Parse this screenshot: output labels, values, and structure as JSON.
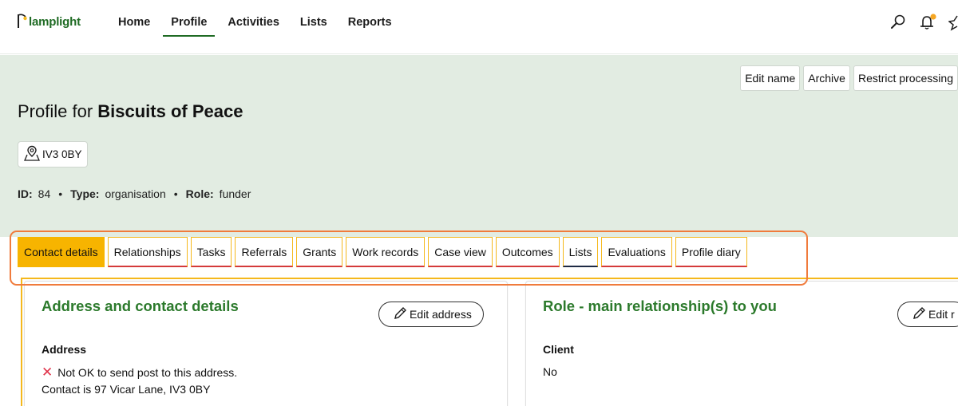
{
  "app": {
    "logo_text": "lamplight"
  },
  "nav": {
    "items": [
      "Home",
      "Profile",
      "Activities",
      "Lists",
      "Reports"
    ],
    "active": 1
  },
  "icons": {
    "search": "search-icon",
    "notifications": "bell-icon",
    "star": "star-icon"
  },
  "header": {
    "buttons": [
      "Edit name",
      "Archive",
      "Restrict processing"
    ],
    "title_prefix": "Profile for ",
    "title_name": "Biscuits of Peace",
    "postcode": "IV3 0BY",
    "meta": {
      "id_label": "ID:",
      "id_value": "84",
      "type_label": "Type:",
      "type_value": "organisation",
      "role_label": "Role:",
      "role_value": "funder",
      "separator": "•"
    }
  },
  "tabs": [
    "Contact details",
    "Relationships",
    "Tasks",
    "Referrals",
    "Grants",
    "Work records",
    "Case view",
    "Outcomes",
    "Lists",
    "Evaluations",
    "Profile diary"
  ],
  "active_tab": 0,
  "address_card": {
    "title": "Address and contact details",
    "edit_label": "Edit address",
    "address_label": "Address",
    "post_status": "Not OK to send post to this address.",
    "contact": "Contact is 97 Vicar Lane, IV3 0BY"
  },
  "role_card": {
    "title": "Role - main relationship(s) to you",
    "edit_label": "Edit r",
    "client_label": "Client",
    "client_value": "No"
  },
  "colors": {
    "brand_green": "#1f6b24",
    "header_bg": "#e2ece2",
    "tab_active": "#f7b400",
    "highlight": "#f07b3c",
    "notification_dot": "#f5a623",
    "error": "#e0344b"
  }
}
